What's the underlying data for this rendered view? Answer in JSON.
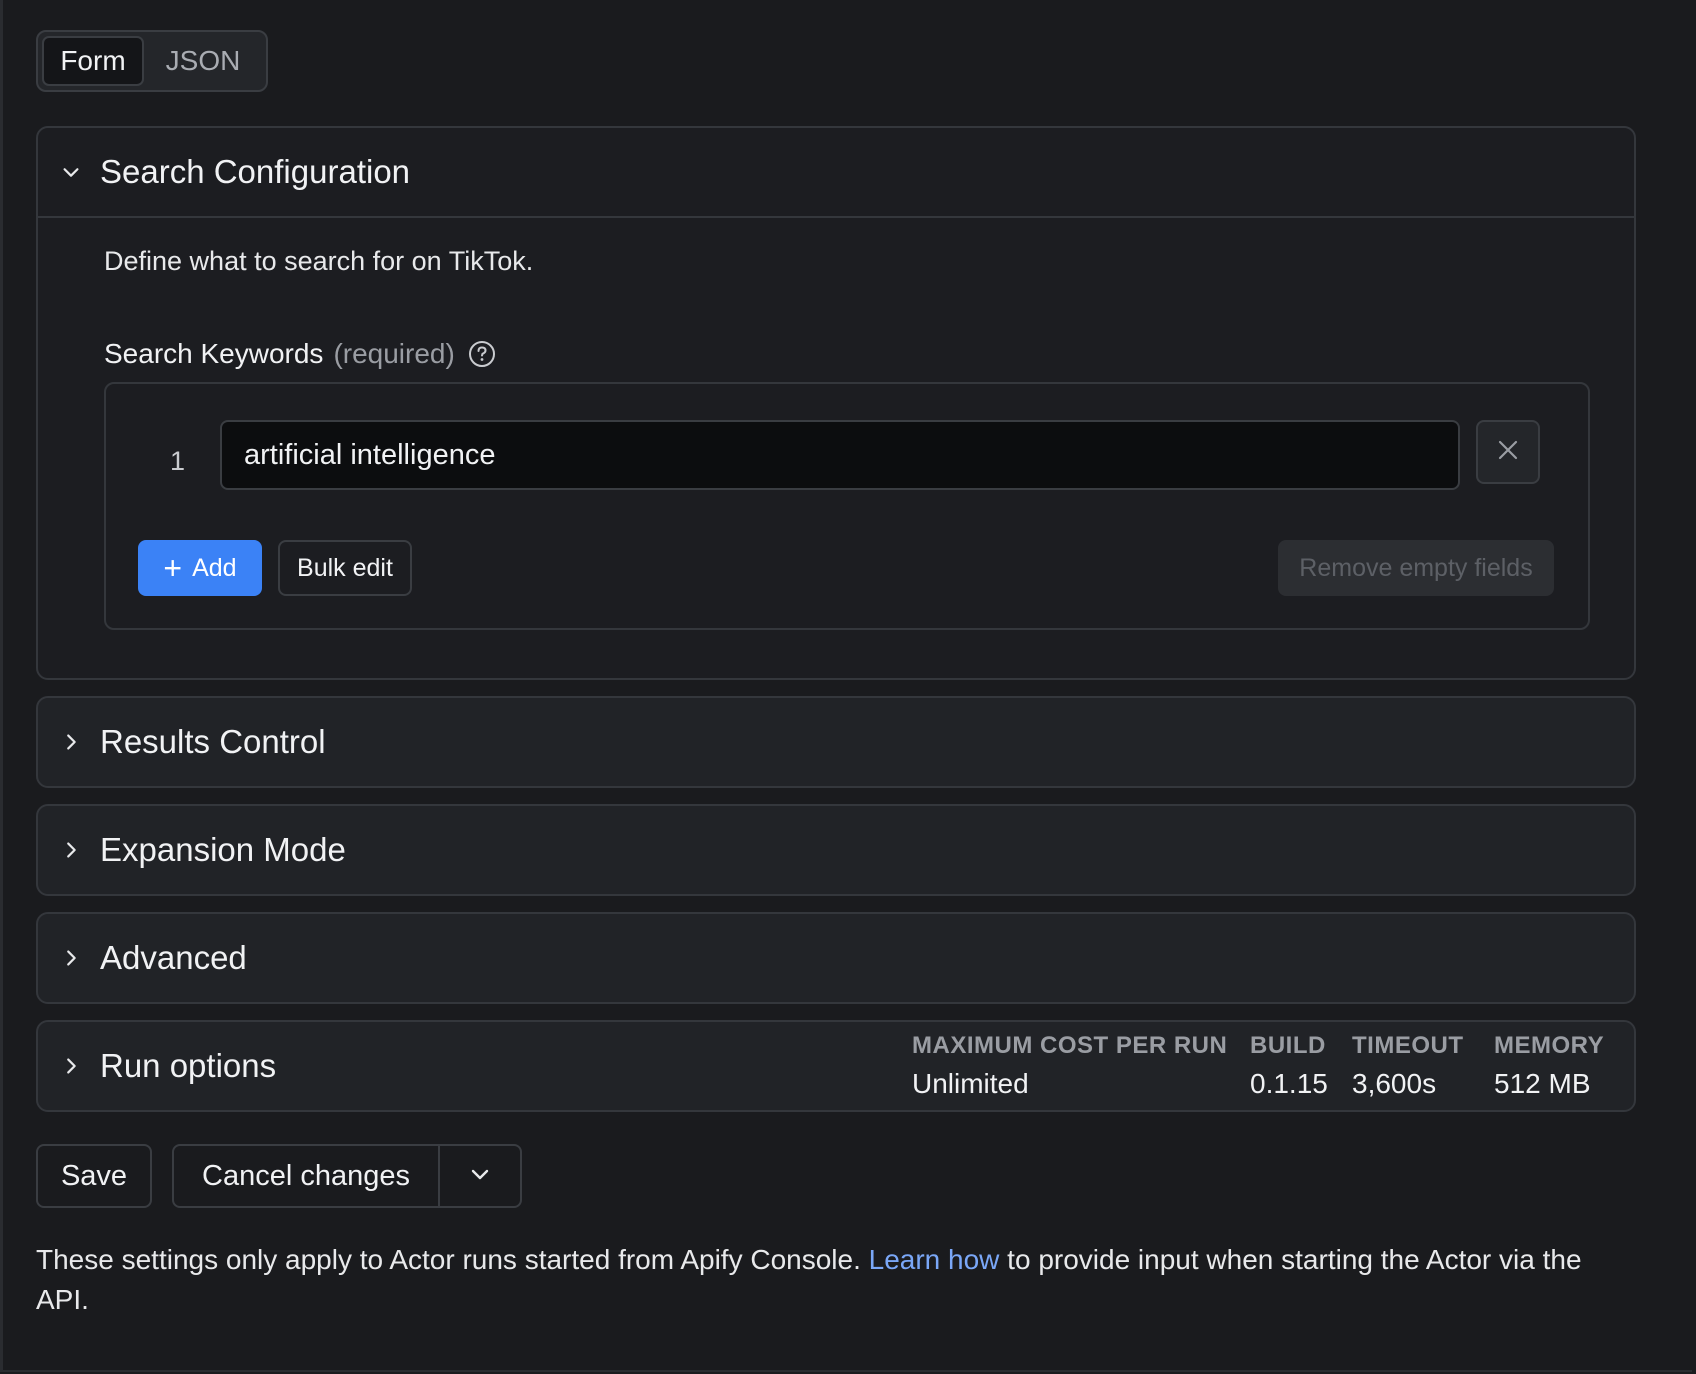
{
  "view_toggle": {
    "form_label": "Form",
    "json_label": "JSON",
    "active": "Form"
  },
  "search_config": {
    "title": "Search Configuration",
    "description": "Define what to search for on TikTok.",
    "keywords_label": "Search Keywords",
    "required_label": "(required)",
    "keywords": [
      {
        "index": "1",
        "value": "artificial intelligence"
      }
    ],
    "add_label": "Add",
    "bulk_edit_label": "Bulk edit",
    "remove_empty_label": "Remove empty fields"
  },
  "sections": {
    "results_control": "Results Control",
    "expansion_mode": "Expansion Mode",
    "advanced": "Advanced"
  },
  "run_options": {
    "title": "Run options",
    "max_cost_key": "MAXIMUM COST PER RUN",
    "max_cost_value": "Unlimited",
    "build_key": "BUILD",
    "build_value": "0.1.15",
    "timeout_key": "TIMEOUT",
    "timeout_value": "3,600s",
    "memory_key": "MEMORY",
    "memory_value": "512 MB"
  },
  "actions": {
    "save_label": "Save",
    "cancel_label": "Cancel changes"
  },
  "footer": {
    "text_before": "These settings only apply to Actor runs started from Apify Console. ",
    "link_text": "Learn how",
    "text_after": " to provide input when starting the Actor via the API."
  },
  "colors": {
    "accent": "#3b82f6",
    "link": "#7aa7f7",
    "background": "#1a1b1e"
  }
}
